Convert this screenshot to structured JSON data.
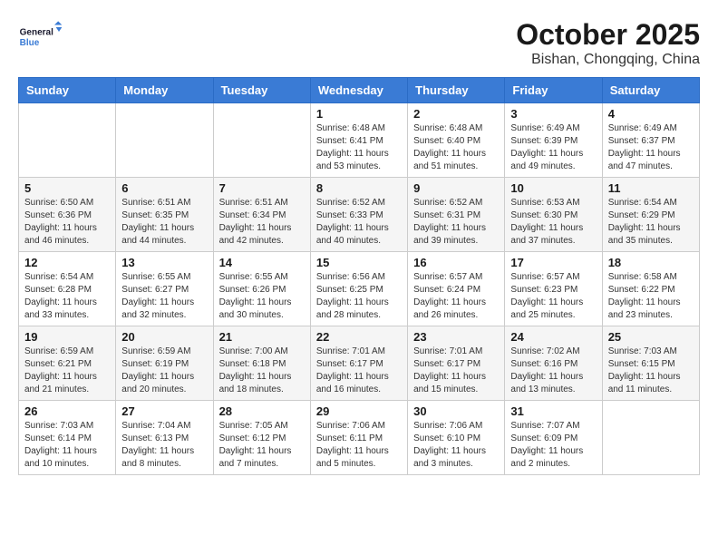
{
  "logo": {
    "line1": "General",
    "line2": "Blue"
  },
  "title": "October 2025",
  "subtitle": "Bishan, Chongqing, China",
  "weekdays": [
    "Sunday",
    "Monday",
    "Tuesday",
    "Wednesday",
    "Thursday",
    "Friday",
    "Saturday"
  ],
  "weeks": [
    [
      {
        "day": "",
        "info": ""
      },
      {
        "day": "",
        "info": ""
      },
      {
        "day": "",
        "info": ""
      },
      {
        "day": "1",
        "info": "Sunrise: 6:48 AM\nSunset: 6:41 PM\nDaylight: 11 hours\nand 53 minutes."
      },
      {
        "day": "2",
        "info": "Sunrise: 6:48 AM\nSunset: 6:40 PM\nDaylight: 11 hours\nand 51 minutes."
      },
      {
        "day": "3",
        "info": "Sunrise: 6:49 AM\nSunset: 6:39 PM\nDaylight: 11 hours\nand 49 minutes."
      },
      {
        "day": "4",
        "info": "Sunrise: 6:49 AM\nSunset: 6:37 PM\nDaylight: 11 hours\nand 47 minutes."
      }
    ],
    [
      {
        "day": "5",
        "info": "Sunrise: 6:50 AM\nSunset: 6:36 PM\nDaylight: 11 hours\nand 46 minutes."
      },
      {
        "day": "6",
        "info": "Sunrise: 6:51 AM\nSunset: 6:35 PM\nDaylight: 11 hours\nand 44 minutes."
      },
      {
        "day": "7",
        "info": "Sunrise: 6:51 AM\nSunset: 6:34 PM\nDaylight: 11 hours\nand 42 minutes."
      },
      {
        "day": "8",
        "info": "Sunrise: 6:52 AM\nSunset: 6:33 PM\nDaylight: 11 hours\nand 40 minutes."
      },
      {
        "day": "9",
        "info": "Sunrise: 6:52 AM\nSunset: 6:31 PM\nDaylight: 11 hours\nand 39 minutes."
      },
      {
        "day": "10",
        "info": "Sunrise: 6:53 AM\nSunset: 6:30 PM\nDaylight: 11 hours\nand 37 minutes."
      },
      {
        "day": "11",
        "info": "Sunrise: 6:54 AM\nSunset: 6:29 PM\nDaylight: 11 hours\nand 35 minutes."
      }
    ],
    [
      {
        "day": "12",
        "info": "Sunrise: 6:54 AM\nSunset: 6:28 PM\nDaylight: 11 hours\nand 33 minutes."
      },
      {
        "day": "13",
        "info": "Sunrise: 6:55 AM\nSunset: 6:27 PM\nDaylight: 11 hours\nand 32 minutes."
      },
      {
        "day": "14",
        "info": "Sunrise: 6:55 AM\nSunset: 6:26 PM\nDaylight: 11 hours\nand 30 minutes."
      },
      {
        "day": "15",
        "info": "Sunrise: 6:56 AM\nSunset: 6:25 PM\nDaylight: 11 hours\nand 28 minutes."
      },
      {
        "day": "16",
        "info": "Sunrise: 6:57 AM\nSunset: 6:24 PM\nDaylight: 11 hours\nand 26 minutes."
      },
      {
        "day": "17",
        "info": "Sunrise: 6:57 AM\nSunset: 6:23 PM\nDaylight: 11 hours\nand 25 minutes."
      },
      {
        "day": "18",
        "info": "Sunrise: 6:58 AM\nSunset: 6:22 PM\nDaylight: 11 hours\nand 23 minutes."
      }
    ],
    [
      {
        "day": "19",
        "info": "Sunrise: 6:59 AM\nSunset: 6:21 PM\nDaylight: 11 hours\nand 21 minutes."
      },
      {
        "day": "20",
        "info": "Sunrise: 6:59 AM\nSunset: 6:19 PM\nDaylight: 11 hours\nand 20 minutes."
      },
      {
        "day": "21",
        "info": "Sunrise: 7:00 AM\nSunset: 6:18 PM\nDaylight: 11 hours\nand 18 minutes."
      },
      {
        "day": "22",
        "info": "Sunrise: 7:01 AM\nSunset: 6:17 PM\nDaylight: 11 hours\nand 16 minutes."
      },
      {
        "day": "23",
        "info": "Sunrise: 7:01 AM\nSunset: 6:17 PM\nDaylight: 11 hours\nand 15 minutes."
      },
      {
        "day": "24",
        "info": "Sunrise: 7:02 AM\nSunset: 6:16 PM\nDaylight: 11 hours\nand 13 minutes."
      },
      {
        "day": "25",
        "info": "Sunrise: 7:03 AM\nSunset: 6:15 PM\nDaylight: 11 hours\nand 11 minutes."
      }
    ],
    [
      {
        "day": "26",
        "info": "Sunrise: 7:03 AM\nSunset: 6:14 PM\nDaylight: 11 hours\nand 10 minutes."
      },
      {
        "day": "27",
        "info": "Sunrise: 7:04 AM\nSunset: 6:13 PM\nDaylight: 11 hours\nand 8 minutes."
      },
      {
        "day": "28",
        "info": "Sunrise: 7:05 AM\nSunset: 6:12 PM\nDaylight: 11 hours\nand 7 minutes."
      },
      {
        "day": "29",
        "info": "Sunrise: 7:06 AM\nSunset: 6:11 PM\nDaylight: 11 hours\nand 5 minutes."
      },
      {
        "day": "30",
        "info": "Sunrise: 7:06 AM\nSunset: 6:10 PM\nDaylight: 11 hours\nand 3 minutes."
      },
      {
        "day": "31",
        "info": "Sunrise: 7:07 AM\nSunset: 6:09 PM\nDaylight: 11 hours\nand 2 minutes."
      },
      {
        "day": "",
        "info": ""
      }
    ]
  ]
}
